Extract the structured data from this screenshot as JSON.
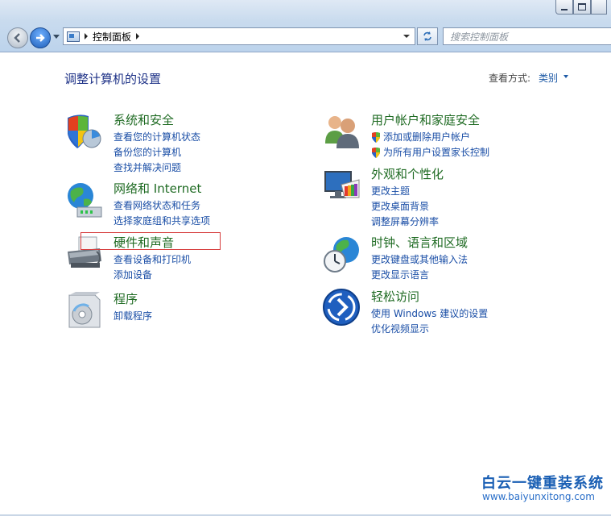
{
  "window": {
    "breadcrumb": [
      "控制面板"
    ],
    "search_placeholder": "搜索控制面板"
  },
  "page": {
    "title": "调整计算机的设置",
    "view_by_label": "查看方式:",
    "view_by_value": "类别"
  },
  "categories": [
    {
      "id": "system-security",
      "title": "系统和安全",
      "icon": "shield-icon",
      "links": [
        {
          "text": "查看您的计算机状态"
        },
        {
          "text": "备份您的计算机"
        },
        {
          "text": "查找并解决问题"
        }
      ]
    },
    {
      "id": "network-internet",
      "title": "网络和 Internet",
      "icon": "globe-network-icon",
      "links": [
        {
          "text": "查看网络状态和任务"
        },
        {
          "text": "选择家庭组和共享选项"
        }
      ]
    },
    {
      "id": "hardware-sound",
      "title": "硬件和声音",
      "icon": "printer-icon",
      "highlighted": true,
      "links": [
        {
          "text": "查看设备和打印机"
        },
        {
          "text": "添加设备"
        }
      ]
    },
    {
      "id": "programs",
      "title": "程序",
      "icon": "programs-icon",
      "links": [
        {
          "text": "卸载程序"
        }
      ]
    },
    {
      "id": "user-accounts",
      "title": "用户帐户和家庭安全",
      "icon": "users-icon",
      "links": [
        {
          "text": "添加或删除用户帐户",
          "shield": true
        },
        {
          "text": "为所有用户设置家长控制",
          "shield": true
        }
      ]
    },
    {
      "id": "appearance",
      "title": "外观和个性化",
      "icon": "monitor-palette-icon",
      "links": [
        {
          "text": "更改主题"
        },
        {
          "text": "更改桌面背景"
        },
        {
          "text": "调整屏幕分辨率"
        }
      ]
    },
    {
      "id": "clock-region",
      "title": "时钟、语言和区域",
      "icon": "clock-globe-icon",
      "links": [
        {
          "text": "更改键盘或其他输入法"
        },
        {
          "text": "更改显示语言"
        }
      ]
    },
    {
      "id": "ease-of-access",
      "title": "轻松访问",
      "icon": "ease-of-access-icon",
      "links": [
        {
          "text": "使用 Windows 建议的设置"
        },
        {
          "text": "优化视频显示"
        }
      ]
    }
  ],
  "watermark": {
    "title": "白云一键重装系统",
    "url": "www.baiyunxitong.com"
  },
  "colors": {
    "category_title": "#1f6b23",
    "link": "#1a4ea6",
    "page_title": "#1e3287",
    "highlight_box": "#d63b3b",
    "watermark": "#1a5fb4"
  }
}
